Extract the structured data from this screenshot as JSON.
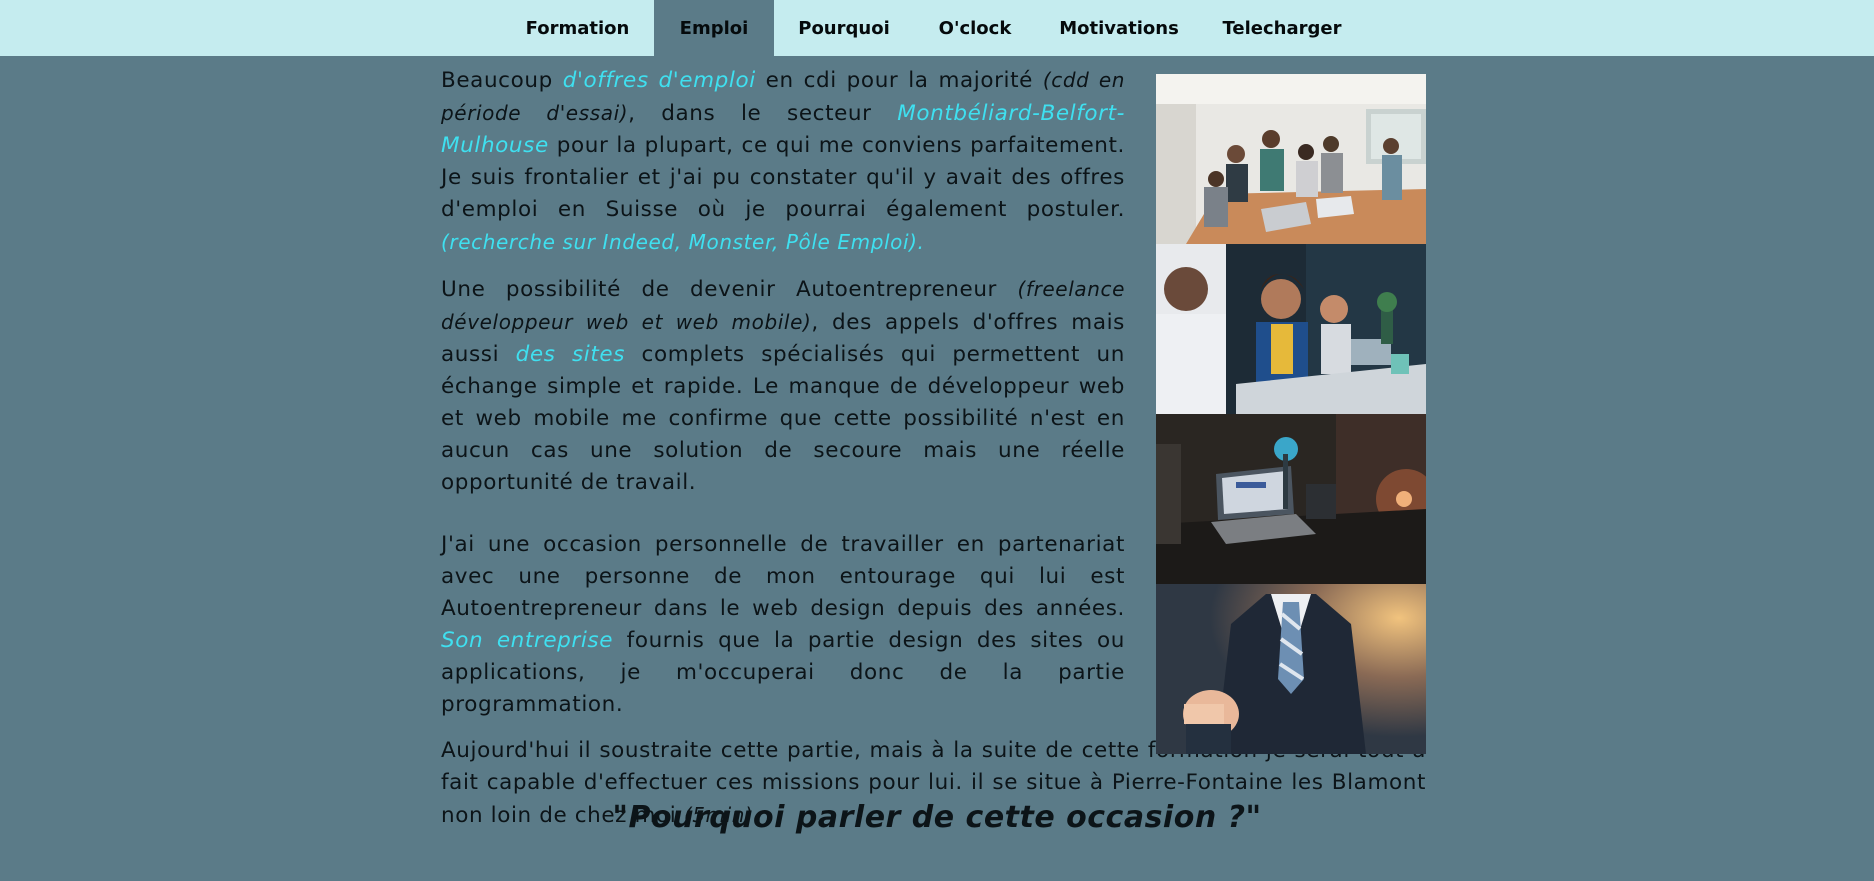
{
  "nav": {
    "items": [
      {
        "label": "Formation"
      },
      {
        "label": "Emploi",
        "active": true
      },
      {
        "label": "Pourquoi"
      },
      {
        "label": "O'clock"
      },
      {
        "label": "Motivations"
      },
      {
        "label": "Telecharger"
      }
    ]
  },
  "content": {
    "p1": {
      "t1": "Beaucoup ",
      "link1": "d'offres d'emploi",
      "t2": " en cdi pour la majorité ",
      "note1": "(cdd en période d'essai)",
      "t3": ", dans le secteur ",
      "link2": "Montbéliard-Belfort-Mulhouse",
      "t4": " pour la plupart, ce qui me conviens parfaitement. Je suis frontalier et j'ai pu constater qu'il y avait des offres d'emploi en Suisse où je pourrai également postuler. ",
      "note2": "(recherche sur Indeed, Monster, Pôle Emploi)."
    },
    "p2": {
      "t1": "Une possibilité de devenir Autoentrepreneur ",
      "note1": "(freelance développeur web et web mobile)",
      "t2": ", des appels d'offres mais aussi ",
      "link1": "des sites",
      "t3": " complets spécialisés qui permettent un échange simple et rapide. Le manque de développeur web et web mobile me confirme que cette possibilité n'est en aucun cas une solution de secoure mais une réelle opportunité de travail."
    },
    "p3": {
      "t1": "J'ai une occasion personnelle de travailler en partenariat avec une personne de mon entourage qui lui est Autoentrepreneur dans le web design depuis des années. ",
      "link1": "Son entreprise",
      "t2": " fournis que la partie design des sites ou applications, je m'occuperai donc de la partie programmation."
    },
    "p4": {
      "t1": "Aujourd'hui il soustraite cette partie, mais à la suite de cette formation je serai tout à fait capable d'effectuer ces missions pour lui. il se situe à Pierre-Fontaine les Blamont non loin de chez moi ",
      "note1": "(5min)."
    },
    "subtitle": "\"Pourquoi parler de cette occasion ?\""
  },
  "photos": [
    {
      "name": "team-meeting-photo"
    },
    {
      "name": "office-workers-photo"
    },
    {
      "name": "desk-laptop-night-photo"
    },
    {
      "name": "businessman-pointing-photo"
    }
  ],
  "colors": {
    "nav_bg": "#c5ecef",
    "page_bg": "#5b7b88",
    "link": "#3fe0f0",
    "text": "#0c1418"
  }
}
